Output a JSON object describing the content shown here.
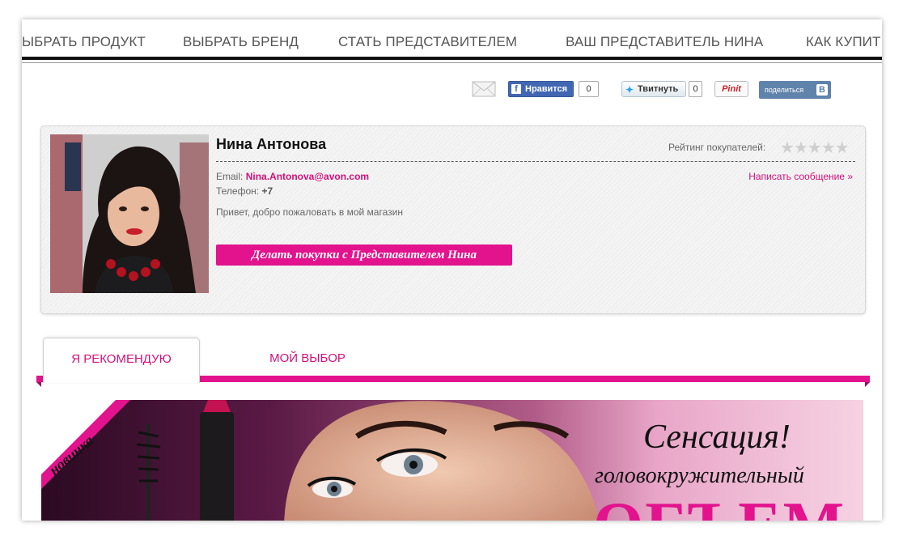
{
  "nav": {
    "items": [
      "ЫБРАТЬ ПРОДУКТ",
      "ВЫБРАТЬ БРЕНД",
      "СТАТЬ ПРЕДСТАВИТЕЛЕМ",
      "ВАШ ПРЕДСТАВИТЕЛЬ НИНА",
      "КАК КУПИТ"
    ]
  },
  "share": {
    "fb_label": "Нравится",
    "fb_count": "0",
    "tw_label": "Твитнуть",
    "tw_count": "0",
    "pin_label": "Pinit",
    "vk_label": "поделиться",
    "vk_letter": "В"
  },
  "profile": {
    "name": "Нина Антонова",
    "rating_label": "Рейтинг покупателей:",
    "rating_value": 0,
    "rating_max": 5,
    "email_label": "Email:",
    "email_value": "Nina.Antonova@avon.com",
    "phone_label": "Телефон:",
    "phone_value": "+7",
    "write_message": "Написать сообщение »",
    "greeting": "Привет, добро пожаловать в мой магазин",
    "shop_button": "Делать покупки с Представителем Нина"
  },
  "tabs": {
    "active": "Я РЕКОМЕНДУЮ",
    "other": "МОЙ ВЫБОР"
  },
  "banner": {
    "badge": "новинка",
    "headline": "Сенсация!",
    "subline": "головокружительный",
    "big_word": "ОБЪЕМ"
  },
  "colors": {
    "accent": "#e2138d",
    "link": "#d1107a",
    "facebook": "#4267b2",
    "vk": "#5f83aa"
  }
}
